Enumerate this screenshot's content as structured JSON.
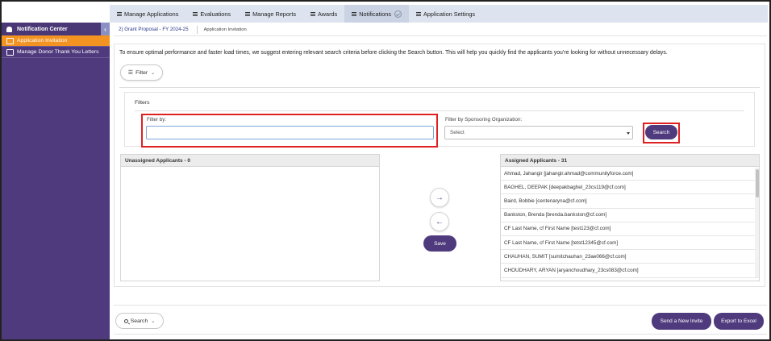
{
  "topnav": {
    "items": [
      {
        "label": "Manage Applications"
      },
      {
        "label": "Evaluations"
      },
      {
        "label": "Manage Reports"
      },
      {
        "label": "Awards"
      },
      {
        "label": "Notifications"
      },
      {
        "label": "Application Settings"
      }
    ]
  },
  "sidebar": {
    "title": "Notification Center",
    "collapse_icon": "‹",
    "items": [
      {
        "label": "Application Invitation"
      },
      {
        "label": "Manage Donor Thank You Letters"
      }
    ]
  },
  "breadcrumb": {
    "program": "2) Grant Proposal - FY 2024-25",
    "page": "Application Invitation"
  },
  "notice": "To ensure optimal performance and faster load times, we suggest entering relevant search criteria before clicking the Search button. This will help you quickly find the applicants you’re looking for without unnecessary delays.",
  "filter_toggle": {
    "label": "Filter"
  },
  "filters": {
    "title": "Filters",
    "filter_by_label": "Filter by:",
    "filter_by_value": "",
    "org_label": "Filter by Sponsoring Organization:",
    "org_value": "Select",
    "search_button": "Search"
  },
  "unassigned": {
    "title": "Unassigned Applicants - 0",
    "items": []
  },
  "assigned": {
    "title": "Assigned Applicants - 31",
    "items": [
      "Ahmad, Jahangir [jahangir.ahmad@communityforce.com]",
      "BAGHEL, DEEPAK [deepakbaghel_23cs119@cf.com]",
      "Baird, Bobbie [centenaryna@cf.com]",
      "Bankston, Brenda [brenda.bankston@cf.com]",
      "CF Last Name, cf First Name [test123@cf.com]",
      "CF Last Name, cf First Name [tetst12345@cf.com]",
      "CHAUHAN, SUMIT [sumitchauhan_23ae066@cf.com]",
      "CHOUDHARY, ARYAN [aryanchoudhary_23cs083@cf.com]"
    ]
  },
  "transfer": {
    "right_arrow": "→",
    "left_arrow": "←",
    "save_button": "Save"
  },
  "bottom": {
    "search_label": "Search",
    "send_invite": "Send a New Invite",
    "export": "Export to Excel"
  },
  "colors": {
    "purple": "#4e3a7d",
    "orange": "#f39322",
    "highlight_red": "#e02020"
  }
}
